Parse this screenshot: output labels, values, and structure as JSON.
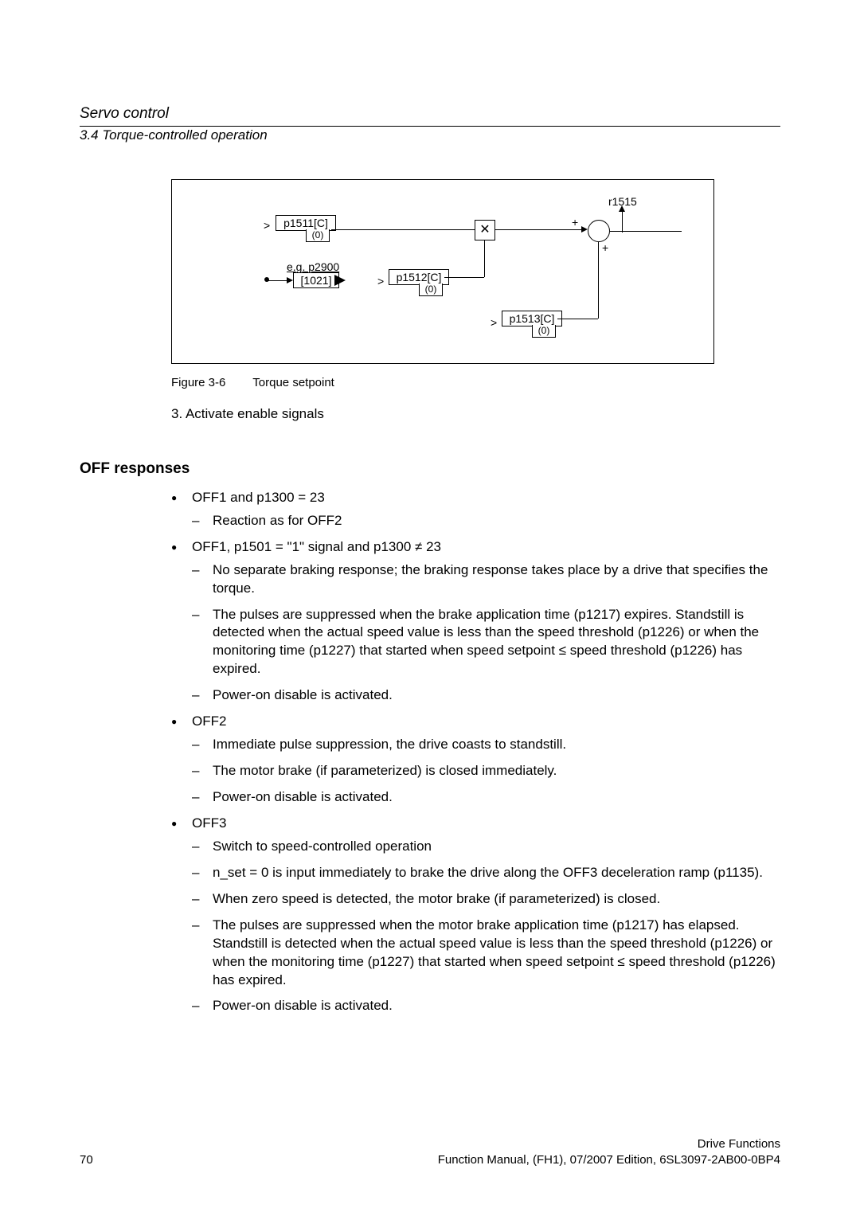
{
  "header": {
    "title": "Servo control",
    "subtitle": "3.4 Torque-controlled operation"
  },
  "figure": {
    "label": "Figure 3-6",
    "caption": "Torque setpoint",
    "blocks": {
      "p1511": "p1511[C]",
      "p1511_def": "(0)",
      "p2900": "e.g. p2900",
      "p2900_ref": "[1021]",
      "p1512": "p1512[C]",
      "p1512_def": "(0)",
      "p1513": "p1513[C]",
      "p1513_def": "(0)",
      "r1515": "r1515"
    }
  },
  "step": "3.  Activate enable signals",
  "section_heading": "OFF responses",
  "items": {
    "off1a": {
      "title": "OFF1 and p1300 = 23",
      "sub": [
        "Reaction as for OFF2"
      ]
    },
    "off1b": {
      "title": "OFF1, p1501 = \"1\" signal and p1300 ≠ 23",
      "sub": [
        "No separate braking response; the braking response takes place by a drive that specifies the torque.",
        "The pulses are suppressed when the brake application time (p1217) expires. Standstill is detected when the actual speed value is less than the speed threshold (p1226) or when the monitoring time (p1227) that started when speed setpoint ≤ speed threshold (p1226) has expired.",
        "Power-on disable is activated."
      ]
    },
    "off2": {
      "title": "OFF2",
      "sub": [
        "Immediate pulse suppression, the drive coasts to standstill.",
        "The motor brake (if parameterized) is closed immediately.",
        "Power-on disable is activated."
      ]
    },
    "off3": {
      "title": "OFF3",
      "sub": [
        "Switch to speed-controlled operation",
        "n_set = 0 is input immediately to brake the drive along the OFF3 deceleration ramp (p1135).",
        "When zero speed is detected, the motor brake (if parameterized) is closed.",
        "The pulses are suppressed when the motor brake application time (p1217) has elapsed. Standstill is detected when the actual speed value is less than the speed threshold (p1226) or when the monitoring time (p1227) that started when speed setpoint ≤ speed threshold (p1226) has expired.",
        "Power-on disable is activated."
      ]
    }
  },
  "footer": {
    "page": "70",
    "right1": "Drive Functions",
    "right2": "Function Manual, (FH1), 07/2007 Edition, 6SL3097-2AB00-0BP4"
  }
}
